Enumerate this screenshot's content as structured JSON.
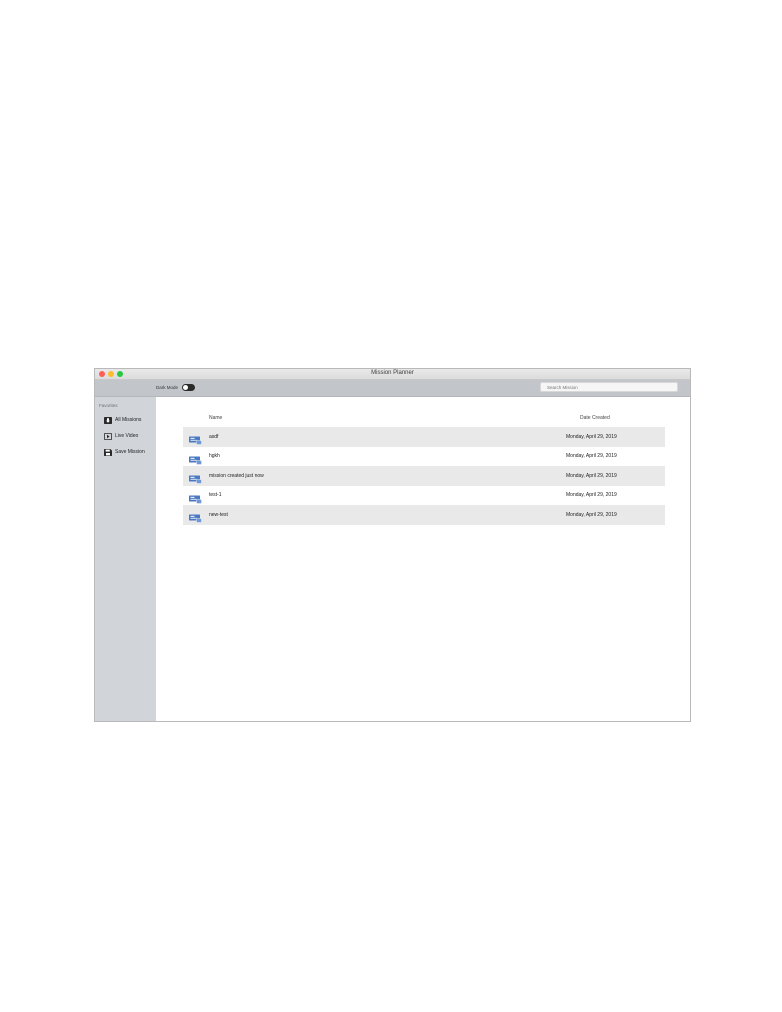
{
  "window": {
    "title": "Mission Planner"
  },
  "toolbar": {
    "dark_mode_label": "Dark Mode",
    "dark_mode_on": true,
    "search_placeholder": "Search Mission"
  },
  "sidebar": {
    "heading": "Favorites",
    "items": [
      {
        "label": "All Missions",
        "icon": "missions-box-icon"
      },
      {
        "label": "Live Video",
        "icon": "play-video-icon"
      },
      {
        "label": "Save Mission",
        "icon": "floppy-disk-icon"
      }
    ]
  },
  "table": {
    "columns": [
      "Name",
      "Date Created"
    ],
    "rows": [
      {
        "name": "asdf",
        "date": "Monday, April 29, 2019",
        "icon": "mission-file-icon"
      },
      {
        "name": "hgkh",
        "date": "Monday, April 29, 2019",
        "icon": "mission-file-icon"
      },
      {
        "name": "mission created just now",
        "date": "Monday, April 29, 2019",
        "icon": "mission-file-icon"
      },
      {
        "name": "test-1",
        "date": "Monday, April 29, 2019",
        "icon": "mission-file-icon"
      },
      {
        "name": "new-test",
        "date": "Monday, April 29, 2019",
        "icon": "mission-file-icon"
      }
    ]
  },
  "colors": {
    "sidebar": "#d1d4d9",
    "toolbar": "#c2c5ca",
    "row_alt": "#e9e9e9",
    "mission_icon": "#4a78c2"
  }
}
